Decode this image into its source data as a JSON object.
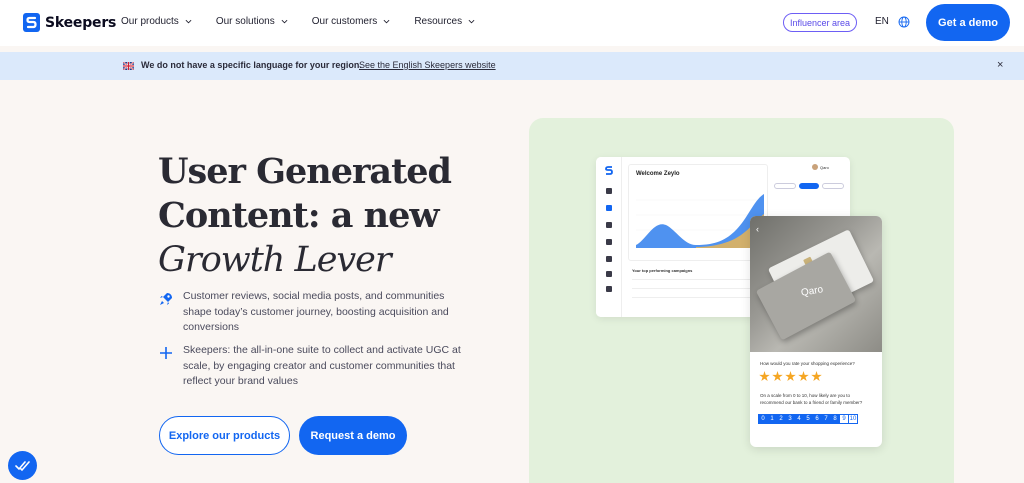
{
  "header": {
    "logo_text": "Skeepers",
    "nav": [
      {
        "label": "Our products"
      },
      {
        "label": "Our solutions"
      },
      {
        "label": "Our customers"
      },
      {
        "label": "Resources"
      }
    ],
    "influencer_label": "Influencer area",
    "language": "EN",
    "cta_label": "Get a demo"
  },
  "banner": {
    "message": "We do not have a specific language for your region.",
    "link_text": "See the English Skeepers website",
    "close": "×"
  },
  "hero": {
    "title_line1": "User Generated",
    "title_line2": "Content: a new",
    "title_line3": "Growth Lever",
    "features": [
      {
        "icon": "rocket-icon",
        "text": "Customer reviews, social media posts, and communities shape today’s customer journey, boosting acquisition and conversions"
      },
      {
        "icon": "plus-icon",
        "text": "Skeepers: the all-in-one suite to collect and activate UGC at scale, by engaging creator and customer communities that reflect your brand values"
      }
    ],
    "primary_button": "Explore our products",
    "secondary_button": "Request a demo"
  },
  "mockup": {
    "dashboard": {
      "welcome": "Welcome Zeylo",
      "table_title": "Your top performing campaigns",
      "user_name": "Qaro"
    },
    "phone": {
      "brand": "Qaro",
      "question_rating": "How would you rate your shopping experience?",
      "rating": 5,
      "question_nps": "On a scale from 0 to 10, how likely are you to recommend our bank to a friend or family member?",
      "scale": [
        "0",
        "1",
        "2",
        "3",
        "4",
        "5",
        "6",
        "7",
        "8",
        "9",
        "10"
      ],
      "selected": "8"
    }
  },
  "colors": {
    "accent": "#1266f1",
    "influencer": "#6d5ef5",
    "banner_bg": "#dbe9fb",
    "visual_bg": "#e3f1dc",
    "star": "#f5a623"
  }
}
